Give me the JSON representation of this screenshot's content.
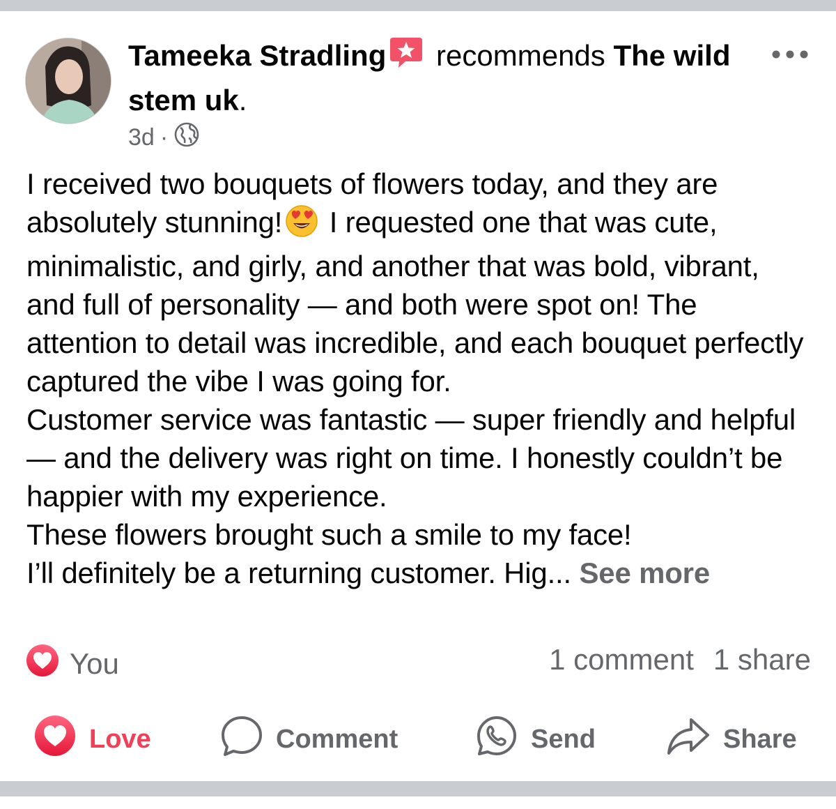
{
  "post": {
    "author": "Tameeka Stradling",
    "action_verb": "recommends",
    "page_name": "The wild stem uk",
    "page_name_suffix": ".",
    "age": "3d",
    "separator": "·",
    "privacy_icon": "globe-icon",
    "menu_icon": "more-dots-icon",
    "badge_icon": "recommendation-star-badge-icon",
    "text": {
      "part1": "I received two bouquets of flowers today, and they are absolutely stunning!",
      "emoji": "heart-eyes-emoji",
      "part2": " I requested one that was cute, minimalistic, and girly, and another that was bold, vibrant, and full of personality — and both were spot on! The attention to detail was incredible, and each bouquet perfectly captured the vibe I was going for.",
      "para2": "Customer service was fantastic — super friendly and helpful — and the delivery was right on time. I honestly couldn’t be happier with my experience.",
      "para3": "These flowers brought such a smile to my face!",
      "para4": "I’ll definitely be a returning customer. Hig...",
      "see_more": "See more"
    }
  },
  "stats": {
    "reaction_icon": "love-reaction-icon",
    "reactors": "You",
    "comments": "1 comment",
    "shares": "1 share"
  },
  "actions": {
    "love": "Love",
    "comment": "Comment",
    "send": "Send",
    "share": "Share"
  },
  "colors": {
    "love_red": "#f33e58",
    "secondary_text": "#65676b",
    "divider_gray": "#c9ccd1",
    "badge_pink": "#f25268"
  }
}
